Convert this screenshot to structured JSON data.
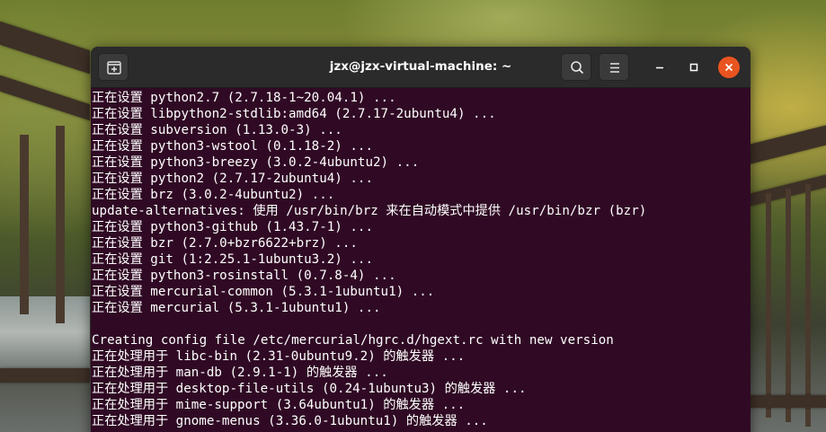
{
  "window": {
    "title": "jzx@jzx-virtual-machine: ~"
  },
  "icons": {
    "new_tab": "new-tab-icon",
    "search": "search-icon",
    "menu": "hamburger-menu-icon",
    "minimize": "minimize-icon",
    "maximize": "maximize-icon",
    "close": "close-icon"
  },
  "colors": {
    "terminal_background": "#300a24",
    "titlebar_background": "#2b2b2b",
    "close_button": "#e95420",
    "text": "#ffffff"
  },
  "terminal": {
    "lines": [
      "正在设置 python2.7 (2.7.18-1~20.04.1) ...",
      "正在设置 libpython2-stdlib:amd64 (2.7.17-2ubuntu4) ...",
      "正在设置 subversion (1.13.0-3) ...",
      "正在设置 python3-wstool (0.1.18-2) ...",
      "正在设置 python3-breezy (3.0.2-4ubuntu2) ...",
      "正在设置 python2 (2.7.17-2ubuntu4) ...",
      "正在设置 brz (3.0.2-4ubuntu2) ...",
      "update-alternatives: 使用 /usr/bin/brz 来在自动模式中提供 /usr/bin/bzr (bzr)",
      "正在设置 python3-github (1.43.7-1) ...",
      "正在设置 bzr (2.7.0+bzr6622+brz) ...",
      "正在设置 git (1:2.25.1-1ubuntu3.2) ...",
      "正在设置 python3-rosinstall (0.7.8-4) ...",
      "正在设置 mercurial-common (5.3.1-1ubuntu1) ...",
      "正在设置 mercurial (5.3.1-1ubuntu1) ...",
      "",
      "Creating config file /etc/mercurial/hgrc.d/hgext.rc with new version",
      "正在处理用于 libc-bin (2.31-0ubuntu9.2) 的触发器 ...",
      "正在处理用于 man-db (2.9.1-1) 的触发器 ...",
      "正在处理用于 desktop-file-utils (0.24-1ubuntu3) 的触发器 ...",
      "正在处理用于 mime-support (3.64ubuntu1) 的触发器 ...",
      "正在处理用于 gnome-menus (3.36.0-1ubuntu1) 的触发器 ..."
    ]
  }
}
